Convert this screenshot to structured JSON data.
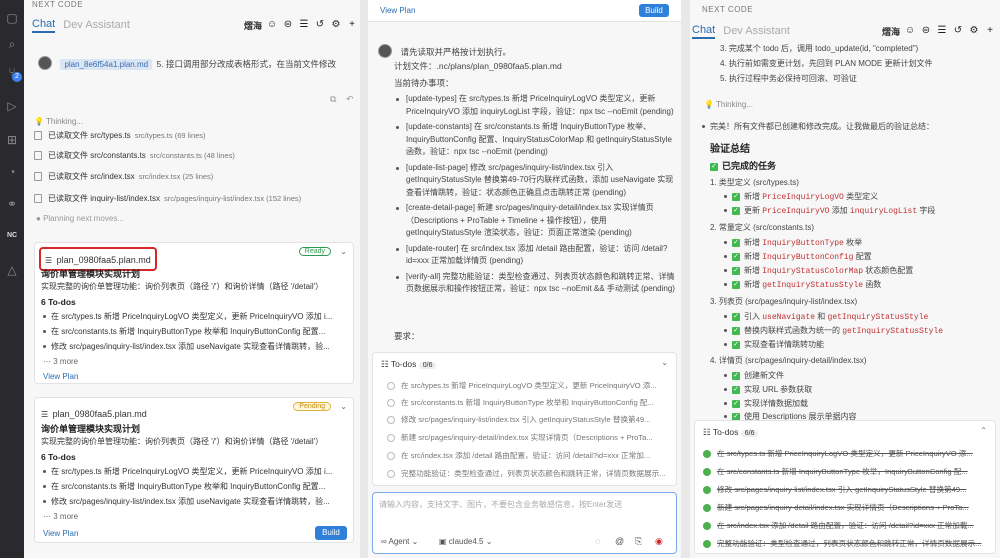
{
  "p1": {
    "header": "NEXT CODE",
    "tab_chat": "Chat",
    "tab_dev": "Dev Assistant",
    "user": "熠海",
    "act_badge": "2",
    "act_nc": "NC",
    "msg_chip": "plan_8e6f54a1.plan.md",
    "msg_text": "5. 接口调用部分改成表格形式，在当前文件修改",
    "thinking": "Thinking...",
    "files": [
      {
        "label": "已读取文件 src/types.ts",
        "meta": "src/types.ts (69 lines)"
      },
      {
        "label": "已读取文件 src/constants.ts",
        "meta": "src/constants.ts (48 lines)"
      },
      {
        "label": "已读取文件 src/index.tsx",
        "meta": "src/index.tsx (25 lines)"
      },
      {
        "label": "已读取文件 inquiry-list/index.tsx",
        "meta": "src/pages/inquiry-list/index.tsx (152 lines)"
      }
    ],
    "planning": "Planning next moves...",
    "card1": {
      "file": "plan_0980faa5.plan.md",
      "status": "Ready",
      "title": "询价单管理模块实现计划",
      "desc": "实现完整的询价单管理功能：询价列表页（路径 '/'）和询价详情（路径 '/detail'）",
      "todos": "6 To-dos",
      "items": [
        "在 src/types.ts 新增 PriceInquiryLogVO 类型定义，更新 PriceInquiryVO 添加 i...",
        "在 src/constants.ts 新增 InquiryButtonType 枚举和 InquiryButtonConfig 配置...",
        "修改 src/pages/inquiry-list/index.tsx 添加 useNavigate 实现查看详情跳转，验..."
      ],
      "more": "3 more",
      "view": "View Plan"
    },
    "card2": {
      "file": "plan_0980faa5.plan.md",
      "status": "Pending",
      "title": "询价单管理模块实现计划",
      "desc": "实现完整的询价单管理功能：询价列表页（路径 '/'）和询价详情（路径 '/detail'）",
      "todos": "6 To-dos",
      "items": [
        "在 src/types.ts 新增 PriceInquiryLogVO 类型定义，更新 PriceInquiryVO 添加 i...",
        "在 src/constants.ts 新增 InquiryButtonType 枚举和 InquiryButtonConfig 配置...",
        "修改 src/pages/inquiry-list/index.tsx 添加 useNavigate 实现查看详情跳转，验..."
      ],
      "more": "3 more",
      "view": "View Plan",
      "build": "Build"
    }
  },
  "p2": {
    "view": "View Plan",
    "build": "Build",
    "msg": "请先读取并严格按计划执行。",
    "plan_file": "计划文件：.nc/plans/plan_0980faa5.plan.md",
    "pending_head": "当前待办事项：",
    "items": [
      "[update-types] 在 src/types.ts 新增 PriceInquiryLogVO 类型定义，更新 PriceInquiryVO 添加 inquiryLogList 字段，验证：npx tsc --noEmit (pending)",
      "[update-constants] 在 src/constants.ts 新增 InquiryButtonType 枚举、InquiryButtonConfig 配置、InquiryStatusColorMap 和 getInquiryStatusStyle 函数，验证：npx tsc --noEmit (pending)",
      "[update-list-page] 修改 src/pages/inquiry-list/index.tsx 引入 getInquiryStatusStyle 替换第49-70行内联样式函数，添加 useNavigate 实现查看详情跳转，验证：状态颜色正确且点击跳转正常 (pending)",
      "[create-detail-page] 新建 src/pages/inquiry-detail/index.tsx 实现详情页（Descriptions + ProTable + Timeline + 操作按钮），使用 getInquiryStatusStyle 渲染状态，验证：页面正常渲染 (pending)",
      "[update-router] 在 src/index.tsx 添加 /detail 路由配置，验证：访问 /detail?id=xxx 正常加载详情页 (pending)",
      "[verify-all] 完整功能验证：类型检查通过、列表页状态颜色和跳转正常、详情页数据展示和操作按钮正常，验证：npx tsc --noEmit && 手动测试 (pending)"
    ],
    "req": "要求：",
    "todos_label": "To-dos",
    "todos_count": "0/6",
    "todos": [
      "在 src/types.ts 新增 PriceInquiryLogVO 类型定义，更新 PriceInquiryVO 添...",
      "在 src/constants.ts 新增 InquiryButtonType 枚举和 InquiryButtonConfig 配...",
      "修改 src/pages/inquiry-list/index.tsx 引入 getInquiryStatusStyle 替换第49...",
      "新建 src/pages/inquiry-detail/index.tsx 实现详情页（Descriptions + ProTa...",
      "在 src/index.tsx 添加 /detail 路由配置，验证：访问 /detail?id=xxx 正常加...",
      "完整功能验证：类型检查通过，列表页状态颜色和跳转正常，详情页数据展示..."
    ],
    "placeholder": "请输入内容，支持文字、图片，不要包含业务敏感信息，按Enter发送",
    "agent": "Agent",
    "model": "claude4.5"
  },
  "p3": {
    "header": "NEXT CODE",
    "tab_chat": "Chat",
    "tab_dev": "Dev Assistant",
    "user": "熠海",
    "top": [
      "3. 完成某个 todo 后，调用 todo_update(id, \"completed\")",
      "4. 执行前如需变更计划，先回到 PLAN MODE 更新计划文件",
      "5. 执行过程中务必保持可回滚、可验证"
    ],
    "thinking": "Thinking...",
    "done_msg": "完美！所有文件都已创建和修改完成。让我做最后的验证总结：",
    "sum_title": "验证总结",
    "done_tasks": "已完成的任务",
    "s1": "1. 类型定义 (src/types.ts)",
    "s1a": "新增",
    "s1a_code": "PriceInquiryLogVO",
    "s1a_t": "类型定义",
    "s1b": "更新",
    "s1b_code": "PriceInquiryVO",
    "s1b_m": "添加",
    "s1b_code2": "inquiryLogList",
    "s1b_t": "字段",
    "s2": "2. 常量定义 (src/constants.ts)",
    "s2a": "新增",
    "s2a_code": "InquiryButtonType",
    "s2a_t": "枚举",
    "s2b": "新增",
    "s2b_code": "InquiryButtonConfig",
    "s2b_t": "配置",
    "s2c": "新增",
    "s2c_code": "InquiryStatusColorMap",
    "s2c_t": "状态颜色配置",
    "s2d": "新增",
    "s2d_code": "getInquiryStatusStyle",
    "s2d_t": "函数",
    "s3": "3. 列表页 (src/pages/inquiry-list/index.tsx)",
    "s3a": "引入",
    "s3a_code": "useNavigate",
    "s3a_m": "和",
    "s3a_code2": "getInquiryStatusStyle",
    "s3b": "替换内联样式函数为统一的",
    "s3b_code": "getInquiryStatusStyle",
    "s3c": "实现查看详情跳转功能",
    "s4": "4. 详情页 (src/pages/inquiry-detail/index.tsx)",
    "s4a": "创建新文件",
    "s4b": "实现 URL 参数获取",
    "s4c": "实现详情数据加载",
    "s4d": "使用 Descriptions 展示单据内容",
    "todos_label": "To-dos",
    "todos_count": "6/6",
    "todos": [
      "在 src/types.ts 新增 PriceInquiryLogVO 类型定义，更新 PriceInquiryVO 添...",
      "在 src/constants.ts 新增 InquiryButtonType 枚举，InquiryButtonConfig 配...",
      "修改 src/pages/inquiry-list/index.tsx 引入 getInquiryStatusStyle 替换第49...",
      "新建 src/pages/inquiry-detail/index.tsx 实现详情页（Descriptions + ProTa...",
      "在 src/index.tsx 添加 /detail 路由配置，验证：访问 /detail?id=xxx 正常加载...",
      "完整功能验证：类型检查通过，列表页状态颜色和跳转正常，详情页数据展示..."
    ]
  }
}
